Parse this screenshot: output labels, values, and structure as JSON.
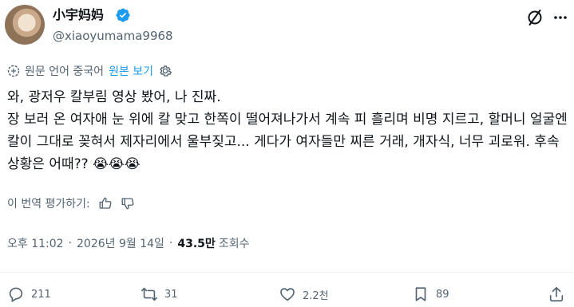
{
  "author": {
    "display_name": "小宇妈妈",
    "handle": "@xiaoyumama9968"
  },
  "translation_bar": {
    "source_label": "원문 언어 중국어",
    "show_original": "원본 보기"
  },
  "tweet": {
    "text": "와, 광저우 칼부림 영상 봤어, 나 진짜.\n장 보러 온 여자애 눈 위에 칼 맞고 한쪽이 떨어져나가서 계속 피 흘리며 비명 지르고, 할머니 얼굴엔 칼이 그대로 꽂혀서 제자리에서 울부짖고... 게다가 여자들만 찌른 거래, 개자식, 너무 괴로워. 후속 상황은 어때?? 😭😭😭"
  },
  "rate_translation": {
    "label": "이 번역 평가하기:"
  },
  "meta": {
    "time": "오후 11:02",
    "sep1": "·",
    "date": "2026년 9월 14일",
    "sep2": "·",
    "views": "43.5만",
    "views_label": "조회수"
  },
  "actions": {
    "replies": "211",
    "reposts": "31",
    "likes": "2.2천",
    "bookmarks": "89"
  },
  "colors": {
    "text": "#0f1419",
    "secondary": "#536471",
    "accent": "#1d9bf0"
  }
}
